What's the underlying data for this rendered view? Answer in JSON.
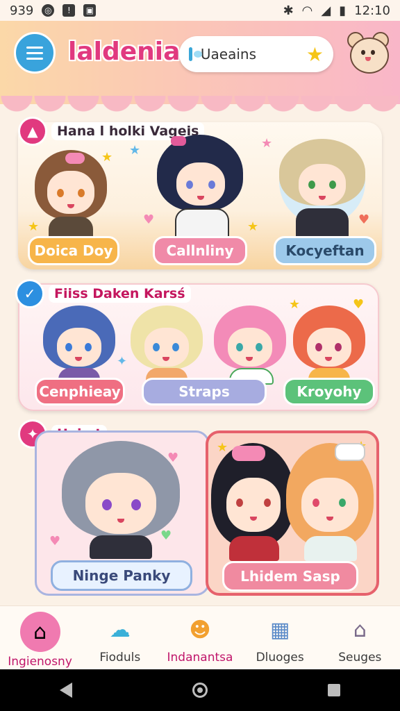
{
  "status_bar": {
    "left_text": "939",
    "time": "12:10"
  },
  "header": {
    "app_title": "laldenia",
    "search_value": "Uaeains",
    "menu_icon": "hamburger-icon",
    "avatar_icon": "bear-icon"
  },
  "sections": [
    {
      "title": "Hana l holki Vageis",
      "badge_icon": "witch-hat-icon",
      "badge_color": "#e1397f",
      "characters": [
        {
          "label": "Doica Doy",
          "pill_color": "#f7b54a"
        },
        {
          "label": "Callnliny",
          "pill_color": "#f08aa8"
        },
        {
          "label": "Kocyeftan",
          "pill_color": "#9dc9ea"
        }
      ]
    },
    {
      "title": "Fiiss Daken Karsś",
      "badge_icon": "check-icon",
      "badge_color": "#2c8fe0",
      "characters": [
        {
          "label": "Cenphieay",
          "pill_color": "#ef6f82"
        },
        {
          "label": "Straps",
          "pill_color": "#a7ace0"
        },
        {
          "label": "Kroyohy",
          "pill_color": "#5cc27a"
        }
      ]
    },
    {
      "title": "Hoimt",
      "badge_icon": "sparkle-heart-icon",
      "badge_color": "#e1397f",
      "cards": [
        {
          "label": "Ninge Panky",
          "pill_color": "#e8f2ff"
        },
        {
          "label": "Lhidem Sasp",
          "pill_color": "#f08aa0"
        }
      ]
    }
  ],
  "bottom_nav": [
    {
      "label": "Ingienosny",
      "icon": "home-icon",
      "active": true
    },
    {
      "label": "Fioduls",
      "icon": "blob-friend-icon",
      "active": false
    },
    {
      "label": "Indanantsa",
      "icon": "smiley-icon",
      "active": false
    },
    {
      "label": "Dluoges",
      "icon": "calendar-icon",
      "active": false
    },
    {
      "label": "Seuges",
      "icon": "house-settings-icon",
      "active": false
    }
  ]
}
